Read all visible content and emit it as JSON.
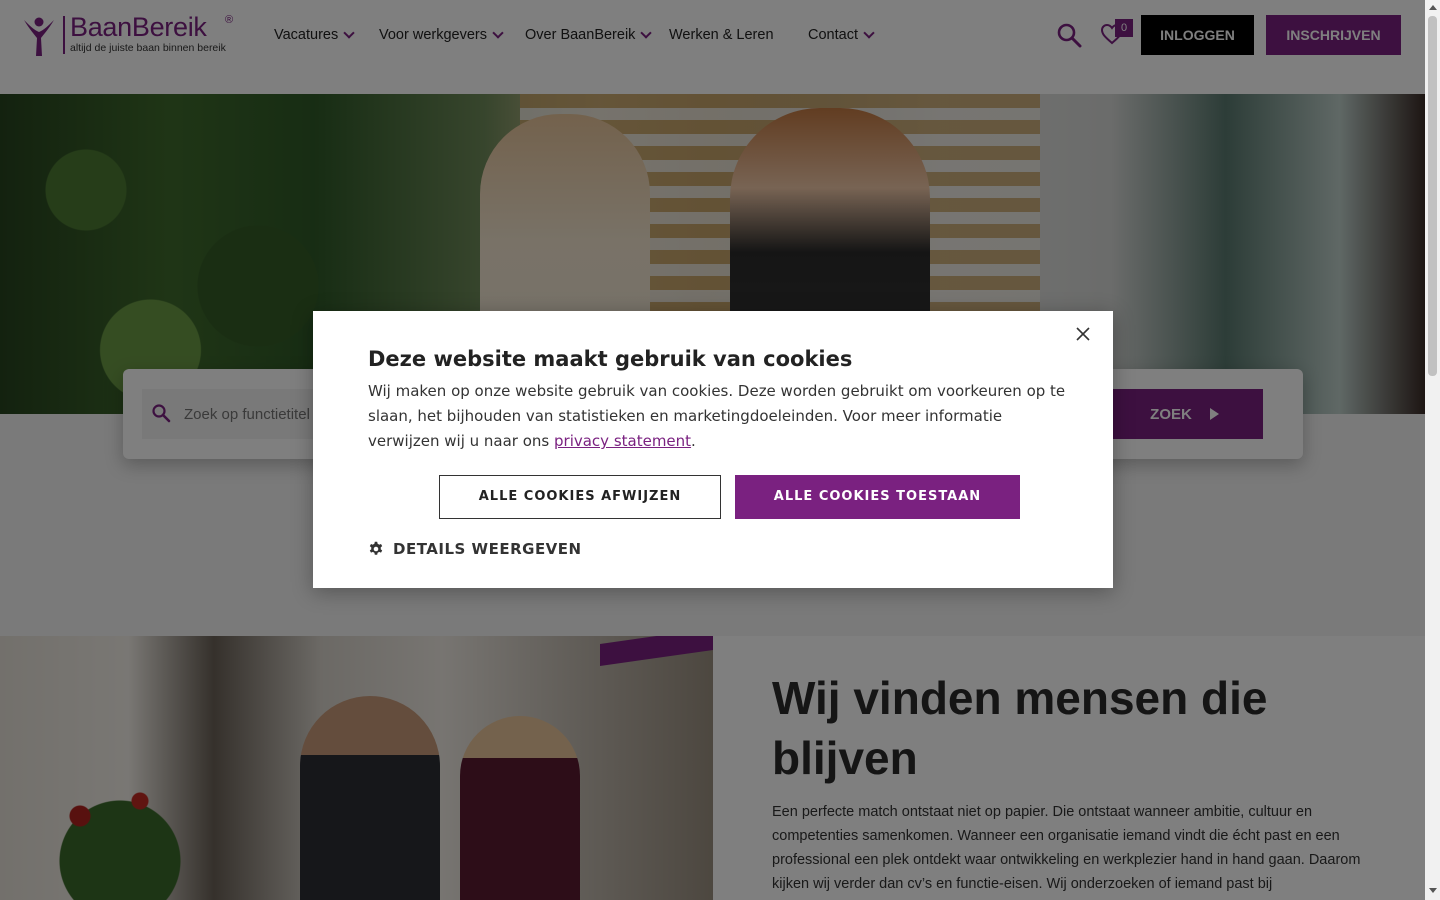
{
  "brand": {
    "name": "BaanBereik",
    "registered": "®",
    "tagline": "altijd de juiste baan binnen bereik",
    "accent_color": "#7a2180"
  },
  "nav": {
    "items": [
      {
        "label": "Vacatures",
        "has_dropdown": true
      },
      {
        "label": "Voor werkgevers",
        "has_dropdown": true
      },
      {
        "label": "Over BaanBereik",
        "has_dropdown": true
      },
      {
        "label": "Werken & Leren",
        "has_dropdown": false
      },
      {
        "label": "Contact",
        "has_dropdown": true
      }
    ],
    "favorites_count": "0",
    "login_label": "INLOGGEN",
    "signup_label": "INSCHRIJVEN"
  },
  "hero_search": {
    "placeholder": "Zoek op functietitel",
    "button_label": "ZOEK"
  },
  "intro": {
    "title": "Wij vinden mensen die blijven",
    "body": "Een perfecte match ontstaat niet op papier. Die ontstaat wanneer ambitie, cultuur en competenties samenkomen. Wanneer een organisatie iemand vindt die écht past en een professional een plek ontdekt waar ontwikkeling en werkplezier hand in hand gaan. Daarom kijken wij verder dan cv’s en functie-eisen. Wij onderzoeken of iemand past bij"
  },
  "cookie_modal": {
    "title": "Deze website maakt gebruik van cookies",
    "body_before_link": "Wij maken op onze website gebruik van cookies. Deze worden gebruikt om voorkeuren op te slaan, het bijhouden van statistieken en marketingdoeleinden. Voor meer informatie verwijzen wij u naar ons ",
    "link_text": "privacy statement",
    "body_after_link": ".",
    "reject_label": "ALLE COOKIES AFWIJZEN",
    "accept_label": "ALLE COOKIES TOESTAAN",
    "details_label": "DETAILS WEERGEVEN"
  }
}
